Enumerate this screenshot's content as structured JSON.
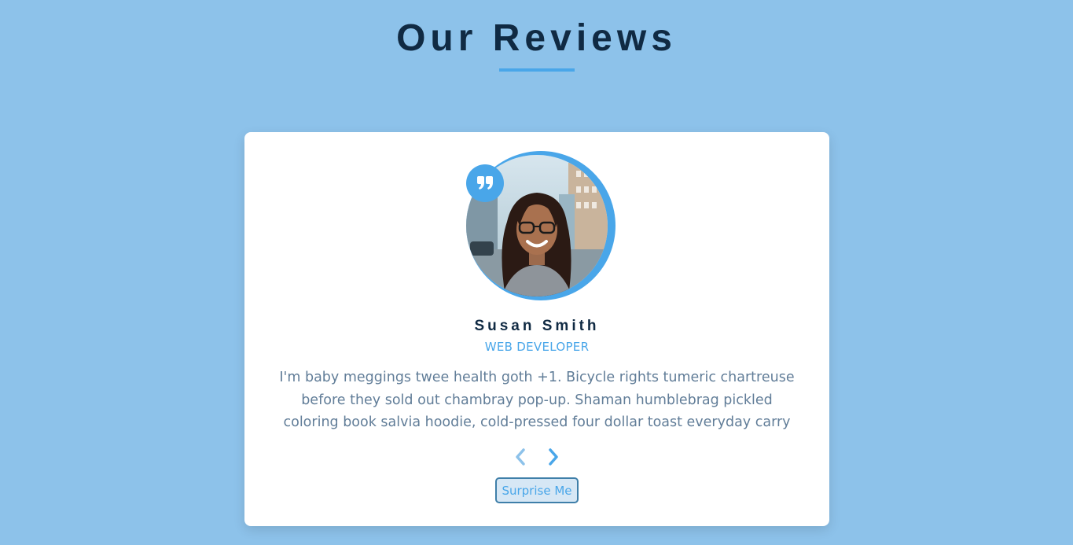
{
  "header": {
    "title": "Our Reviews"
  },
  "review": {
    "name": "Susan Smith",
    "job": "web developer",
    "text": "I'm baby meggings twee health goth +1. Bicycle rights tumeric chartreuse before they sold out chambray pop-up. Shaman humblebrag pickled coloring book salvia hoodie, cold-pressed four dollar toast everyday carry"
  },
  "controls": {
    "prev_icon": "chevron-left-icon",
    "next_icon": "chevron-right-icon",
    "random_label": "Surprise Me"
  },
  "colors": {
    "background": "#8dc2ea",
    "primary": "#49a6e9",
    "title": "#102a43",
    "text": "#617d98"
  }
}
